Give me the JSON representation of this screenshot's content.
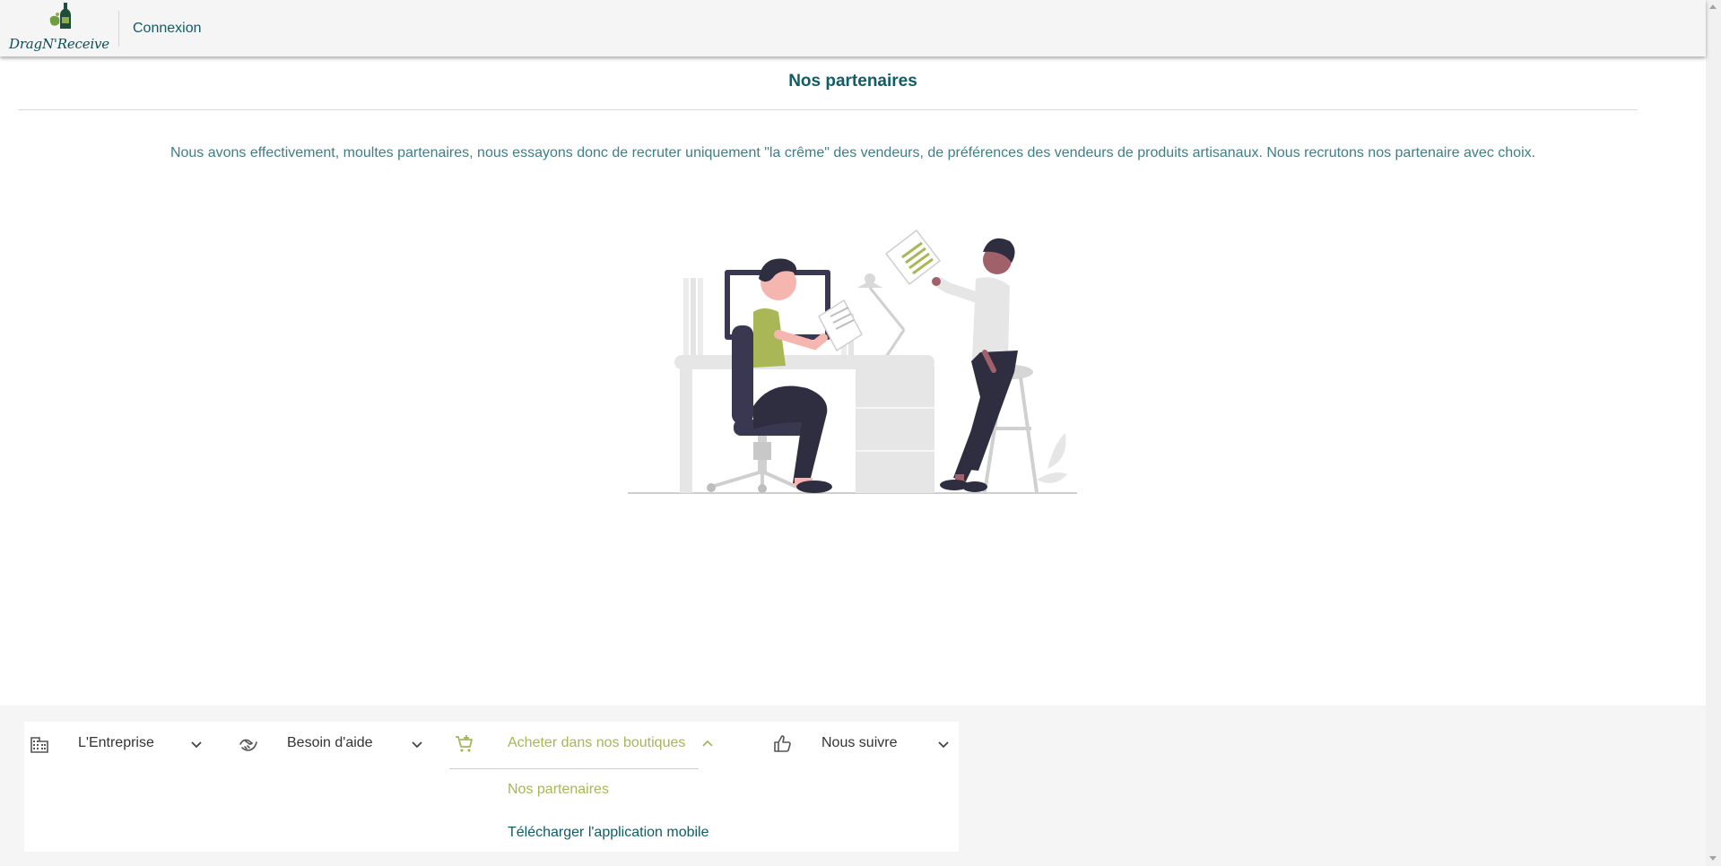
{
  "header": {
    "logo_text": "DragN'Receive",
    "login_label": "Connexion"
  },
  "main": {
    "title": "Nos partenaires",
    "description": "Nous avons effectivement, moultes partenaires, nous essayons donc de recruter uniquement \"la crême\" des vendeurs, de préférences des vendeurs de produits artisanaux. Nous recrutons nos partenaire avec choix."
  },
  "footer": {
    "groups": [
      {
        "label": "L'Entreprise",
        "icon": "building-icon",
        "expanded": false
      },
      {
        "label": "Besoin d'aide",
        "icon": "handshake-icon",
        "expanded": false
      },
      {
        "label": "Acheter dans nos boutiques",
        "icon": "cart-icon",
        "expanded": true
      },
      {
        "label": "Nous suivre",
        "icon": "thumbs-up-icon",
        "expanded": false
      }
    ],
    "submenu": [
      "Nos partenaires",
      "Télécharger l'application mobile"
    ]
  },
  "colors": {
    "primary_teal": "#0f5d66",
    "accent_green": "#a3b85a",
    "text_dark": "#333333",
    "background_light": "#f5f5f5"
  }
}
